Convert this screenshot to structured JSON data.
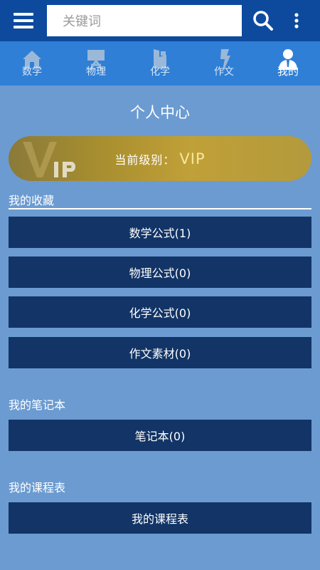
{
  "search": {
    "placeholder": "关键词"
  },
  "tabs": [
    {
      "label": "数学",
      "icon": "home-icon",
      "active": false
    },
    {
      "label": "物理",
      "icon": "easel-icon",
      "active": false
    },
    {
      "label": "化学",
      "icon": "flask-icon",
      "active": false
    },
    {
      "label": "作文",
      "icon": "pen-icon",
      "active": false
    },
    {
      "label": "我的",
      "icon": "user-icon",
      "active": true
    }
  ],
  "page": {
    "title": "个人中心"
  },
  "vip": {
    "label": "当前级别：",
    "level": "VIP"
  },
  "favorites": {
    "title": "我的收藏",
    "items": [
      "数学公式(1)",
      "物理公式(0)",
      "化学公式(0)",
      "作文素材(0)"
    ]
  },
  "notes": {
    "title": "我的笔记本",
    "button": "笔记本(0)"
  },
  "schedule": {
    "title": "我的课程表",
    "button": "我的课程表"
  },
  "colors": {
    "topbar": "#0d4a9e",
    "tabbar": "#2f7fd6",
    "background": "#6b9bd1",
    "button": "#123466",
    "vip_gold": "#b39a3c"
  }
}
